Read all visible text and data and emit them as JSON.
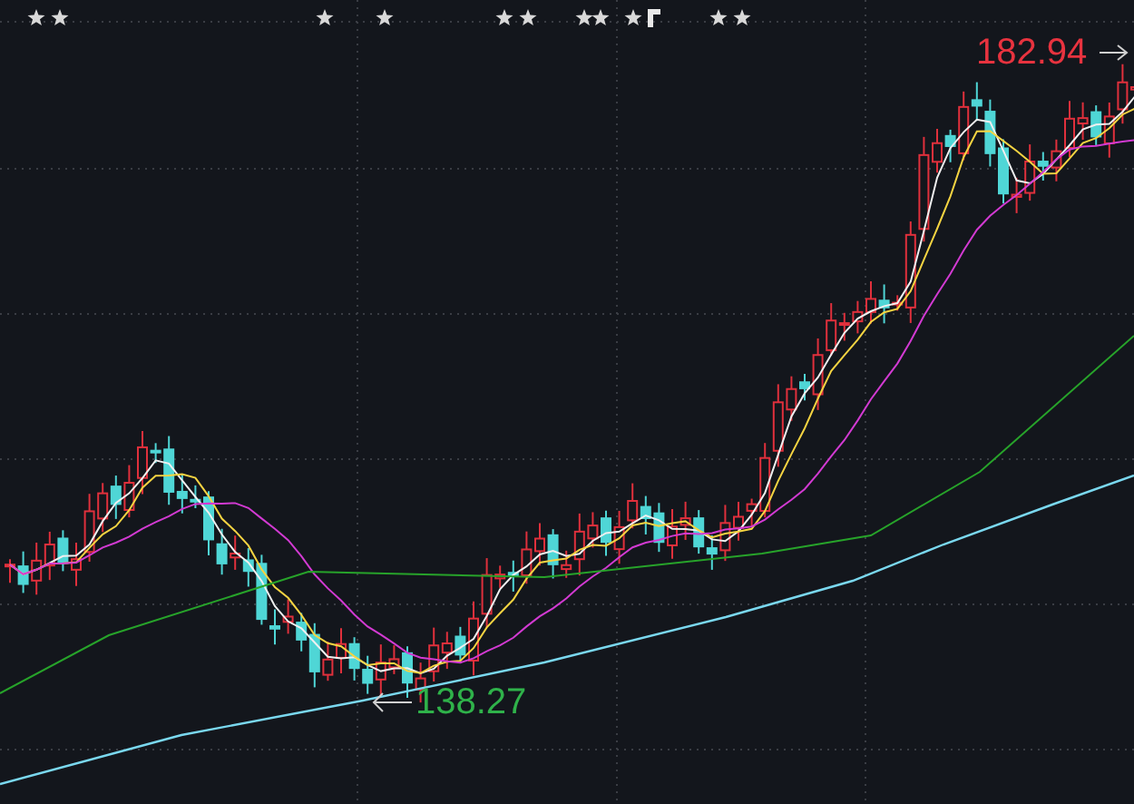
{
  "chart": {
    "high_label": "182.94",
    "low_label": "138.27"
  }
}
